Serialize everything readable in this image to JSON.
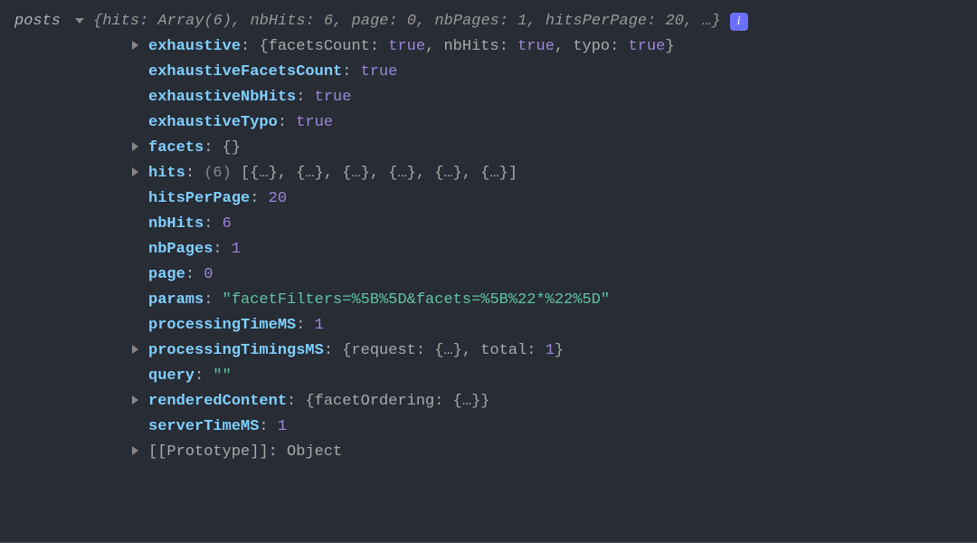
{
  "varName": "posts",
  "topSummary": "{hits: Array(6), nbHits: 6, page: 0, nbPages: 1, hitsPerPage: 20, …}",
  "fields": [
    {
      "expandable": true,
      "key": "exhaustive",
      "after": "{facetsCount: ",
      "valParts": [
        {
          "t": "bool",
          "v": "true"
        },
        {
          "t": "obj",
          "v": ", nbHits: "
        },
        {
          "t": "bool",
          "v": "true"
        },
        {
          "t": "obj",
          "v": ", typo: "
        },
        {
          "t": "bool",
          "v": "true"
        },
        {
          "t": "obj",
          "v": "}"
        }
      ]
    },
    {
      "expandable": false,
      "key": "exhaustiveFacetsCount",
      "valParts": [
        {
          "t": "bool",
          "v": "true"
        }
      ]
    },
    {
      "expandable": false,
      "key": "exhaustiveNbHits",
      "valParts": [
        {
          "t": "bool",
          "v": "true"
        }
      ]
    },
    {
      "expandable": false,
      "key": "exhaustiveTypo",
      "valParts": [
        {
          "t": "bool",
          "v": "true"
        }
      ]
    },
    {
      "expandable": true,
      "key": "facets",
      "valParts": [
        {
          "t": "obj",
          "v": "{}"
        }
      ]
    },
    {
      "expandable": true,
      "key": "hits",
      "valParts": [
        {
          "t": "count",
          "v": "(6) "
        },
        {
          "t": "obj",
          "v": "[{…}, {…}, {…}, {…}, {…}, {…}]"
        }
      ]
    },
    {
      "expandable": false,
      "key": "hitsPerPage",
      "valParts": [
        {
          "t": "num",
          "v": "20"
        }
      ]
    },
    {
      "expandable": false,
      "key": "nbHits",
      "valParts": [
        {
          "t": "num",
          "v": "6"
        }
      ]
    },
    {
      "expandable": false,
      "key": "nbPages",
      "valParts": [
        {
          "t": "num",
          "v": "1"
        }
      ]
    },
    {
      "expandable": false,
      "key": "page",
      "valParts": [
        {
          "t": "num",
          "v": "0"
        }
      ]
    },
    {
      "expandable": false,
      "key": "params",
      "valParts": [
        {
          "t": "str",
          "v": "\"facetFilters=%5B%5D&facets=%5B%22*%22%5D\""
        }
      ]
    },
    {
      "expandable": false,
      "key": "processingTimeMS",
      "valParts": [
        {
          "t": "num",
          "v": "1"
        }
      ]
    },
    {
      "expandable": true,
      "key": "processingTimingsMS",
      "valParts": [
        {
          "t": "obj",
          "v": "{request: {…}, total: "
        },
        {
          "t": "num",
          "v": "1"
        },
        {
          "t": "obj",
          "v": "}"
        }
      ]
    },
    {
      "expandable": false,
      "key": "query",
      "valParts": [
        {
          "t": "str",
          "v": "\"\""
        }
      ]
    },
    {
      "expandable": true,
      "key": "renderedContent",
      "keyOverride": "renderedContent",
      "valParts": [
        {
          "t": "obj",
          "v": "{facetOrdering: {…}}"
        }
      ]
    },
    {
      "expandable": false,
      "key": "serverTimeMS",
      "valParts": [
        {
          "t": "num",
          "v": "1"
        }
      ]
    },
    {
      "expandable": true,
      "key": "[[Prototype]]",
      "proto": true,
      "valParts": [
        {
          "t": "obj",
          "v": "Object"
        }
      ]
    }
  ],
  "renderedContentKey": "renderedContent"
}
